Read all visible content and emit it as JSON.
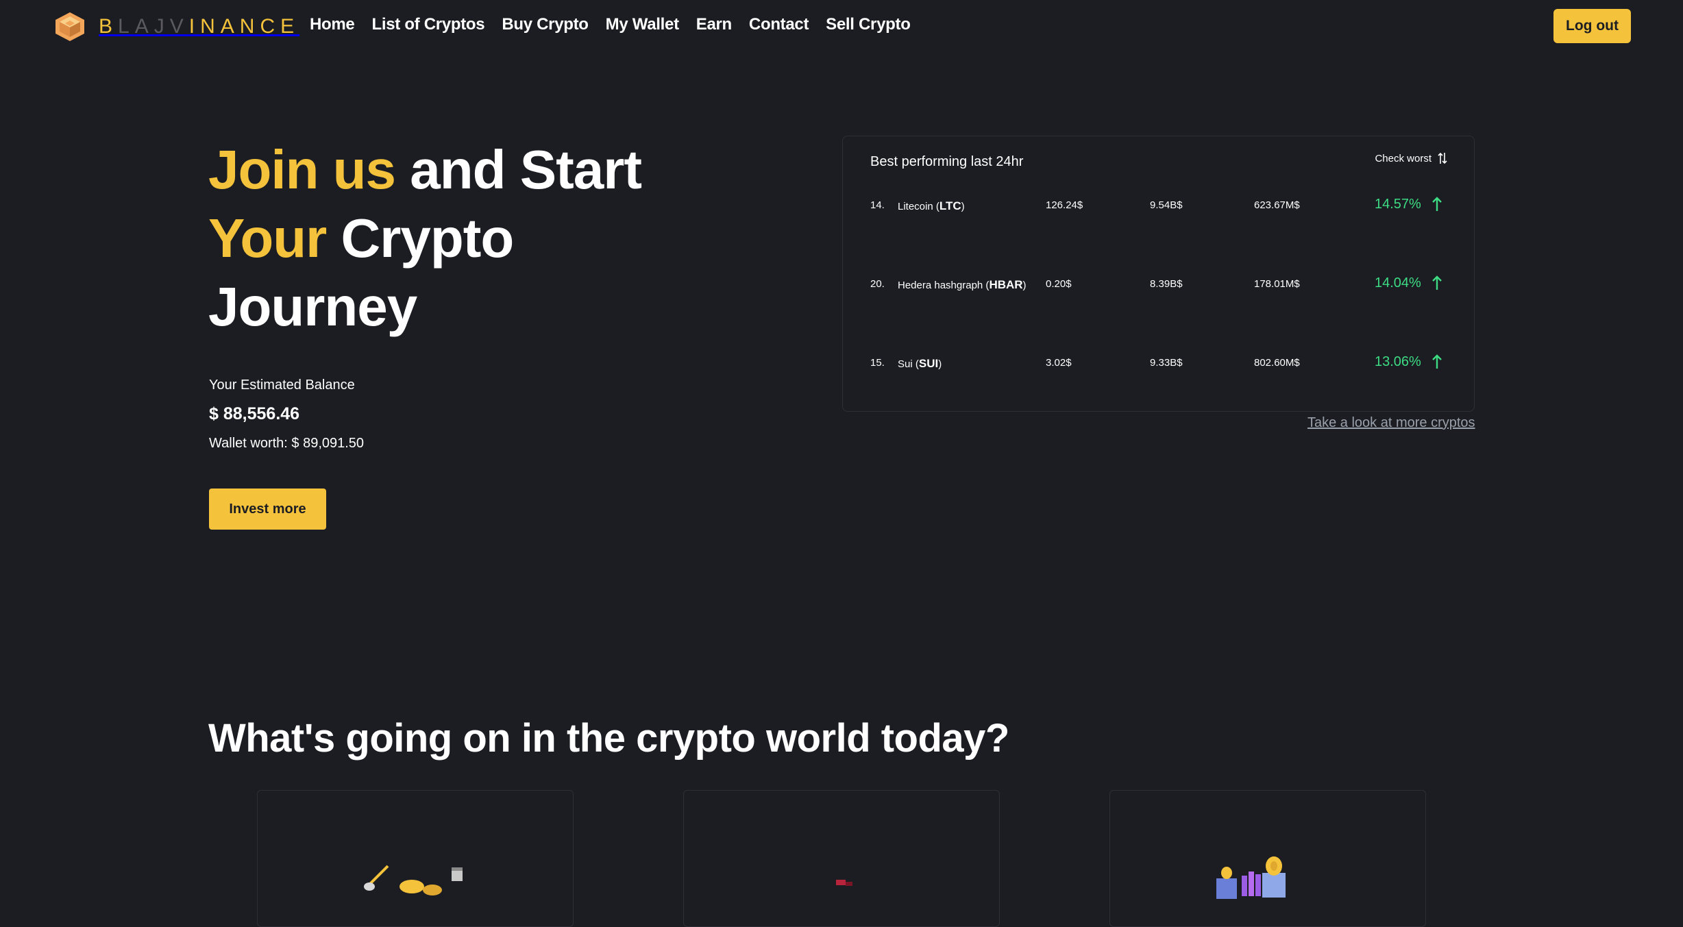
{
  "brand": {
    "name_letters": [
      {
        "ch": "B",
        "tone": "y"
      },
      {
        "ch": "L",
        "tone": "g"
      },
      {
        "ch": "A",
        "tone": "g"
      },
      {
        "ch": "J",
        "tone": "g"
      },
      {
        "ch": "V",
        "tone": "g"
      },
      {
        "ch": "I",
        "tone": "y"
      },
      {
        "ch": "N",
        "tone": "y"
      },
      {
        "ch": "A",
        "tone": "y"
      },
      {
        "ch": "N",
        "tone": "y"
      },
      {
        "ch": "C",
        "tone": "y"
      },
      {
        "ch": "E",
        "tone": "y"
      }
    ],
    "logo_icon": "hexagon-cube-logo-icon",
    "accent_color": "#f5c33b"
  },
  "nav": {
    "links": [
      "Home",
      "List of Cryptos",
      "Buy Crypto",
      "My Wallet",
      "Earn",
      "Contact",
      "Sell Crypto"
    ],
    "logout_label": "Log out"
  },
  "hero": {
    "title_parts": {
      "join_us": "Join us",
      "and_start": " and Start",
      "your": "Your",
      "crypto": " Crypto",
      "journey": "Journey"
    },
    "balance_label": "Your Estimated Balance",
    "balance_value": "$ 88,556.46",
    "wallet_worth": "Wallet worth: $ 89,091.50",
    "invest_label": "Invest more"
  },
  "performance": {
    "title": "Best performing last 24hr",
    "toggle_label": "Check worst",
    "toggle_icon": "sort-arrows-icon",
    "rows": [
      {
        "rank": "14.",
        "name": "Litecoin",
        "symbol": "LTC",
        "price": "126.24$",
        "market_cap": "9.54B$",
        "volume": "623.67M$",
        "change": "14.57%"
      },
      {
        "rank": "20.",
        "name": "Hedera hashgraph",
        "symbol": "HBAR",
        "price": "0.20$",
        "market_cap": "8.39B$",
        "volume": "178.01M$",
        "change": "14.04%"
      },
      {
        "rank": "15.",
        "name": "Sui",
        "symbol": "SUI",
        "price": "3.02$",
        "market_cap": "9.33B$",
        "volume": "802.60M$",
        "change": "13.06%"
      }
    ],
    "change_color": "#3ddc84",
    "more_link": "Take a look at more cryptos"
  },
  "news": {
    "heading": "What's going on in the crypto world today?",
    "cards": [
      {
        "illustration": "coins-growth-illustration"
      },
      {
        "illustration": "crypto-news-illustration"
      },
      {
        "illustration": "exchange-blocks-illustration"
      }
    ]
  }
}
